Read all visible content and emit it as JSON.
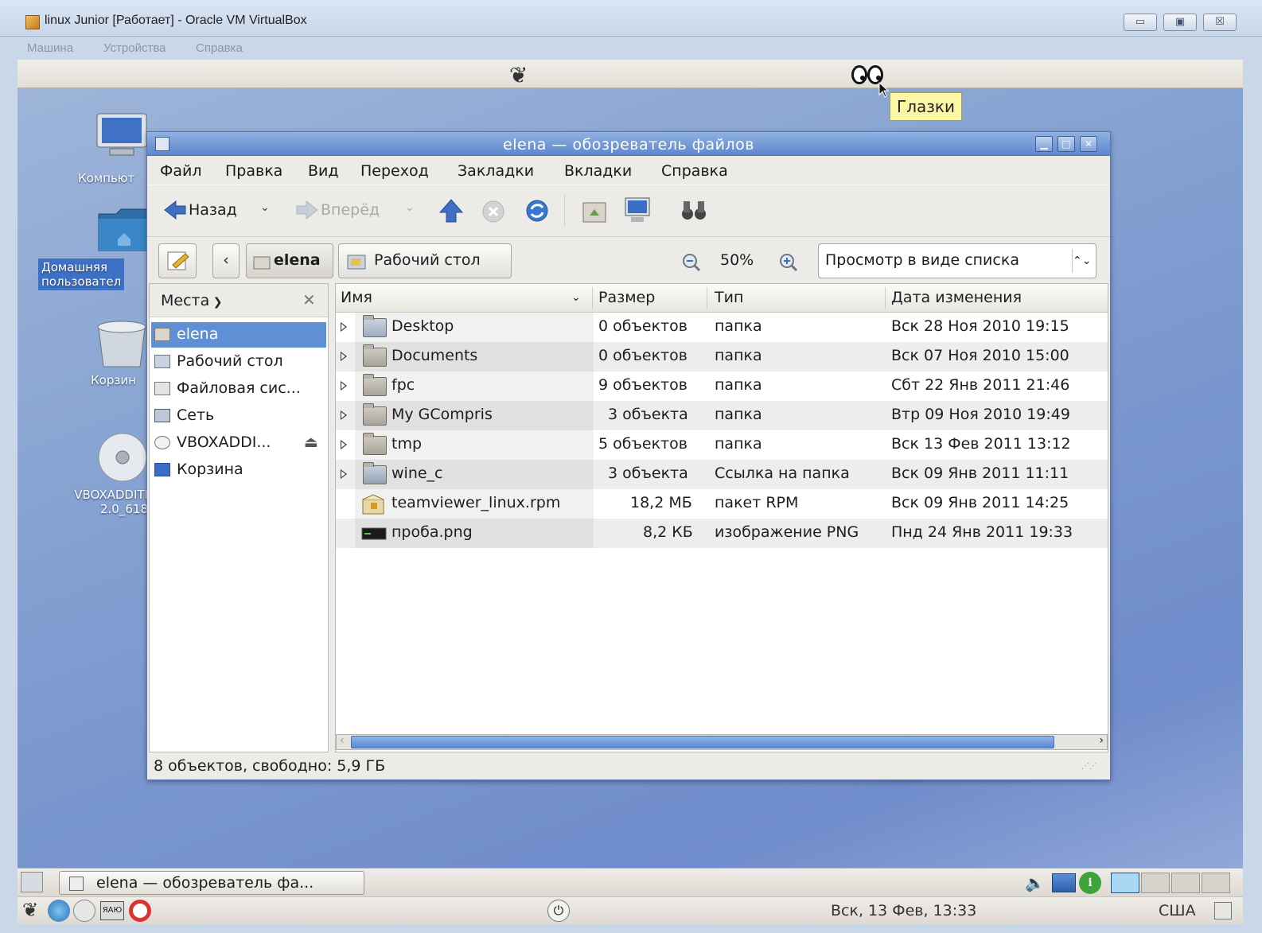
{
  "host": {
    "title": "linux Junior [Работает] - Oracle VM VirtualBox",
    "menu": [
      "Машина",
      "Устройства",
      "Справка"
    ],
    "controls": {
      "minimize": "▭",
      "restore": "▣",
      "close": "☒"
    }
  },
  "guest": {
    "tooltip": "Глазки",
    "desktop_icons": [
      {
        "label": "Компьют",
        "icon": "computer-icon"
      },
      {
        "label_line1": "Домашняя",
        "label_line2": "пользовател",
        "icon": "home-folder-icon"
      },
      {
        "label": "Корзин",
        "icon": "trash-icon"
      },
      {
        "label_line1": "VBOXADDITI",
        "label_line2": "2.0_618",
        "icon": "cdrom-icon"
      }
    ]
  },
  "nautilus": {
    "title": "elena — обозреватель файлов",
    "menu": [
      "Файл",
      "Правка",
      "Вид",
      "Переход",
      "Закладки",
      "Вкладки",
      "Справка"
    ],
    "toolbar": {
      "back": "Назад",
      "forward": "Вперёд"
    },
    "location": {
      "current": "elena",
      "next": "Рабочий стол",
      "zoom": "50%",
      "view_mode": "Просмотр в виде списка"
    },
    "sidebar": {
      "title": "Места",
      "places": [
        {
          "label": "elena",
          "selected": true
        },
        {
          "label": "Рабочий стол"
        },
        {
          "label": "Файловая сис..."
        },
        {
          "label": "Сеть"
        },
        {
          "label": "VBOXADDI..."
        },
        {
          "label": "Корзина"
        }
      ]
    },
    "columns": [
      "Имя",
      "Размер",
      "Тип",
      "Дата изменения"
    ],
    "files": [
      {
        "name": "Desktop",
        "size": "0 объектов",
        "type": "папка",
        "date": "Вск 28 Ноя 2010 19:15"
      },
      {
        "name": "Documents",
        "size": "0 объектов",
        "type": "папка",
        "date": "Вск 07 Ноя 2010 15:00"
      },
      {
        "name": "fpc",
        "size": "9 объектов",
        "type": "папка",
        "date": "Сбт 22 Янв 2011 21:46"
      },
      {
        "name": "My GCompris",
        "size": "3 объекта",
        "type": "папка",
        "date": "Втр 09 Ноя 2010 19:49"
      },
      {
        "name": "tmp",
        "size": "5 объектов",
        "type": "папка",
        "date": "Вск 13 Фев 2011 13:12"
      },
      {
        "name": "wine_c",
        "size": "3 объекта",
        "type": "Ссылка на папка",
        "date": "Вск 09 Янв 2011 11:11"
      },
      {
        "name": "teamviewer_linux.rpm",
        "size": "18,2 МБ",
        "type": "пакет RPM",
        "date": "Вск 09 Янв 2011 14:25"
      },
      {
        "name": "проба.png",
        "size": "8,2 КБ",
        "type": "изображение PNG",
        "date": "Пнд 24 Янв 2011 19:33"
      }
    ],
    "status": "8 объектов, свободно: 5,9 ГБ"
  },
  "panels": {
    "task_label": "elena — обозреватель фа...",
    "clock": "Вск, 13 Фев, 13:33",
    "keyboard_layout": "США"
  }
}
